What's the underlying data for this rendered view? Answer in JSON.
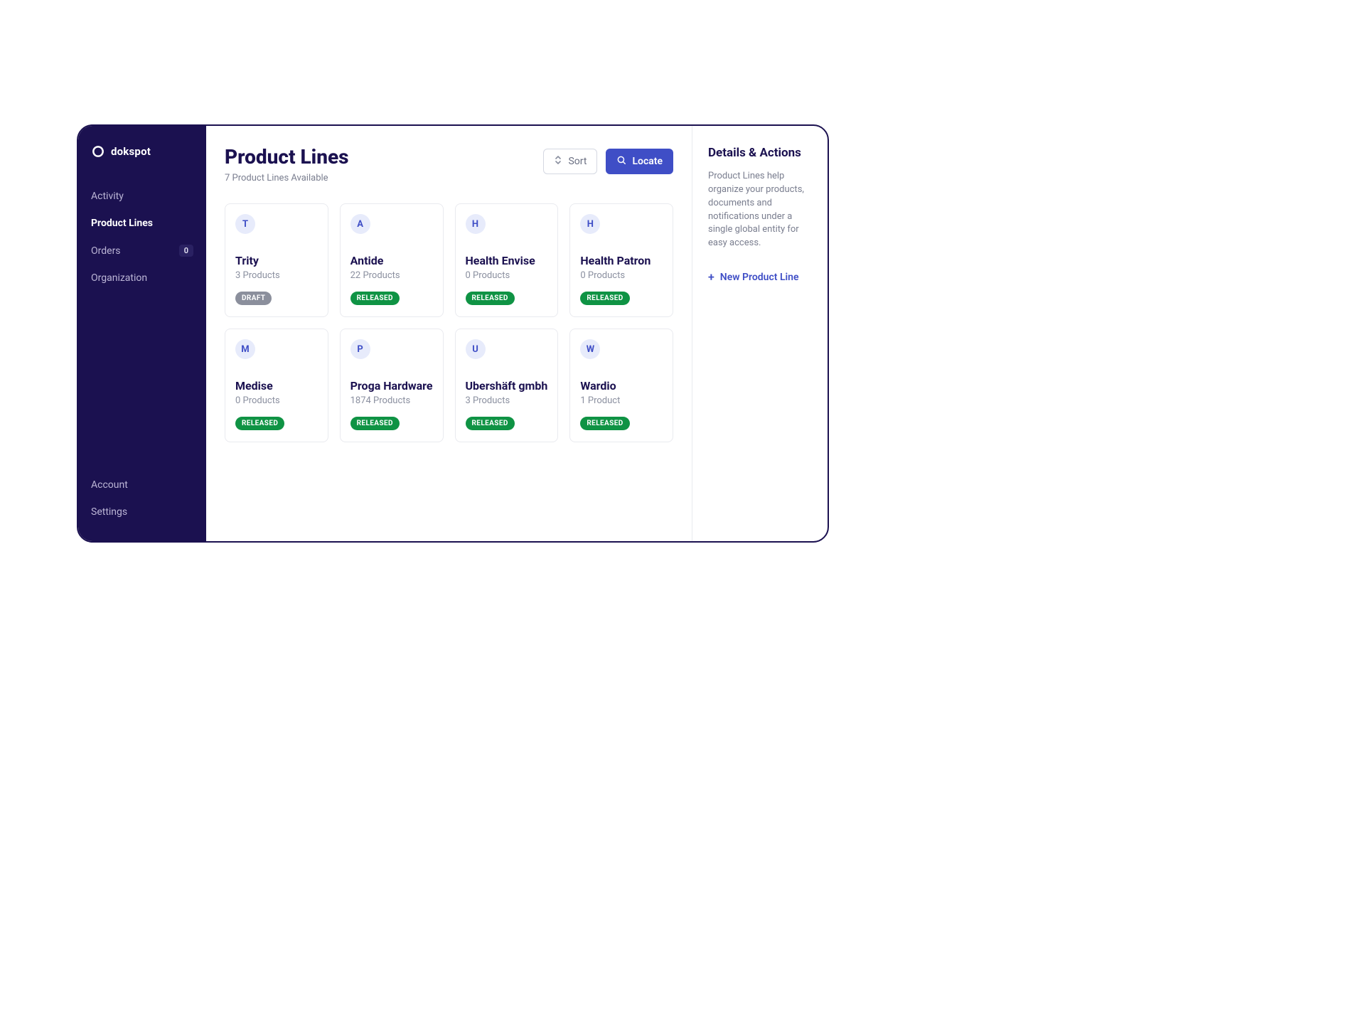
{
  "brand": {
    "name": "dokspot"
  },
  "sidebar": {
    "top_items": [
      {
        "label": "Activity",
        "active": false
      },
      {
        "label": "Product Lines",
        "active": true
      },
      {
        "label": "Orders",
        "active": false,
        "badge": "0"
      },
      {
        "label": "Organization",
        "active": false
      }
    ],
    "bottom_items": [
      {
        "label": "Account"
      },
      {
        "label": "Settings"
      }
    ]
  },
  "header": {
    "title": "Product Lines",
    "subtitle": "7 Product Lines Available",
    "sort_label": "Sort",
    "locate_label": "Locate"
  },
  "cards": [
    {
      "letter": "T",
      "name": "Trity",
      "subtitle": "3 Products",
      "status": "DRAFT",
      "status_kind": "draft"
    },
    {
      "letter": "A",
      "name": "Antide",
      "subtitle": "22 Products",
      "status": "RELEASED",
      "status_kind": "released"
    },
    {
      "letter": "H",
      "name": "Health Envise",
      "subtitle": "0 Products",
      "status": "RELEASED",
      "status_kind": "released"
    },
    {
      "letter": "H",
      "name": "Health Patron",
      "subtitle": "0 Products",
      "status": "RELEASED",
      "status_kind": "released"
    },
    {
      "letter": "M",
      "name": "Medise",
      "subtitle": "0 Products",
      "status": "RELEASED",
      "status_kind": "released"
    },
    {
      "letter": "P",
      "name": "Proga Hardware",
      "subtitle": "1874 Products",
      "status": "RELEASED",
      "status_kind": "released"
    },
    {
      "letter": "U",
      "name": "Ubershäft gmbh",
      "subtitle": "3 Products",
      "status": "RELEASED",
      "status_kind": "released"
    },
    {
      "letter": "W",
      "name": "Wardio",
      "subtitle": "1 Product",
      "status": "RELEASED",
      "status_kind": "released"
    }
  ],
  "panel": {
    "title": "Details & Actions",
    "text": "Product Lines help organize your products, documents and notifications under a single global entity for easy access.",
    "new_label": "New Product Line"
  }
}
